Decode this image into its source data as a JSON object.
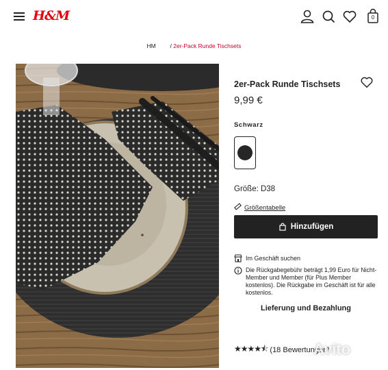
{
  "header": {
    "logo": "H&M",
    "icons": [
      "menu-icon",
      "user-icon",
      "search-icon",
      "heart-icon",
      "bag-icon"
    ],
    "bag_count": "0"
  },
  "breadcrumb": {
    "root": "HM",
    "separator": "/",
    "current": "2er-Pack Runde Tischsets"
  },
  "product": {
    "title": "2er-Pack Runde Tischsets",
    "price": "9,99 €",
    "color_label": "Schwarz",
    "size": "Größe: D38",
    "size_guide": "Größentabelle",
    "add_button": "Hinzufügen",
    "store_search": "Im Geschäft suchen",
    "returns_info": "Die Rückgabegebühr beträgt 1,99 Euro für Nicht-Member und Member (für Plus Member kostenlos). Die Rückgabe im Geschäft ist für alle kostenlos.",
    "delivery": "Lieferung und Bezahlung",
    "rating_value": 4.5,
    "reviews": "(18 Bewertungen)"
  },
  "colors": {
    "brand": "#e50010",
    "breadcrumb_current": "#c3002f",
    "button_bg": "#222222"
  },
  "watermark": "Avito"
}
